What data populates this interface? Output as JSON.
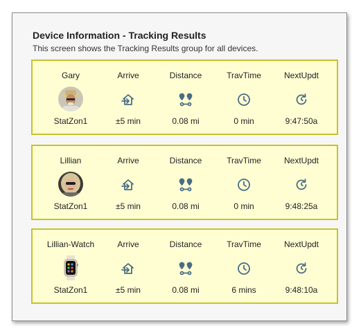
{
  "header": {
    "title": "Device Information - Tracking Results",
    "subtitle": "This screen shows the Tracking Results group for all devices."
  },
  "colors": {
    "card_bg": "#fffed3",
    "card_border": "#c5c32a",
    "icon": "#4a6d86"
  },
  "devices": [
    {
      "name": "Gary",
      "zone": "StatZon1",
      "arrive_label": "Arrive",
      "arrive_icon": "arrive-icon",
      "arrive": "±5 min",
      "distance_label": "Distance",
      "distance_icon": "route-icon",
      "distance": "0.08 mi",
      "travtime_label": "TravTime",
      "travtime_icon": "clock-icon",
      "travtime": "0 min",
      "nextupdt_label": "NextUpdt",
      "nextupdt_icon": "refresh-icon",
      "nextupdt": "9:47:50a"
    },
    {
      "name": "Lillian",
      "zone": "StatZon1",
      "arrive_label": "Arrive",
      "arrive_icon": "arrive-icon",
      "arrive": "±5 min",
      "distance_label": "Distance",
      "distance_icon": "route-icon",
      "distance": "0.08 mi",
      "travtime_label": "TravTime",
      "travtime_icon": "clock-icon",
      "travtime": "0 min",
      "nextupdt_label": "NextUpdt",
      "nextupdt_icon": "refresh-icon",
      "nextupdt": "9:48:25a"
    },
    {
      "name": "Lillian-Watch",
      "zone": "StatZon1",
      "arrive_label": "Arrive",
      "arrive_icon": "arrive-icon",
      "arrive": "±5 min",
      "distance_label": "Distance",
      "distance_icon": "route-icon",
      "distance": "0.08 mi",
      "travtime_label": "TravTime",
      "travtime_icon": "clock-icon",
      "travtime": "6 mins",
      "nextupdt_label": "NextUpdt",
      "nextupdt_icon": "refresh-icon",
      "nextupdt": "9:48:10a"
    }
  ]
}
